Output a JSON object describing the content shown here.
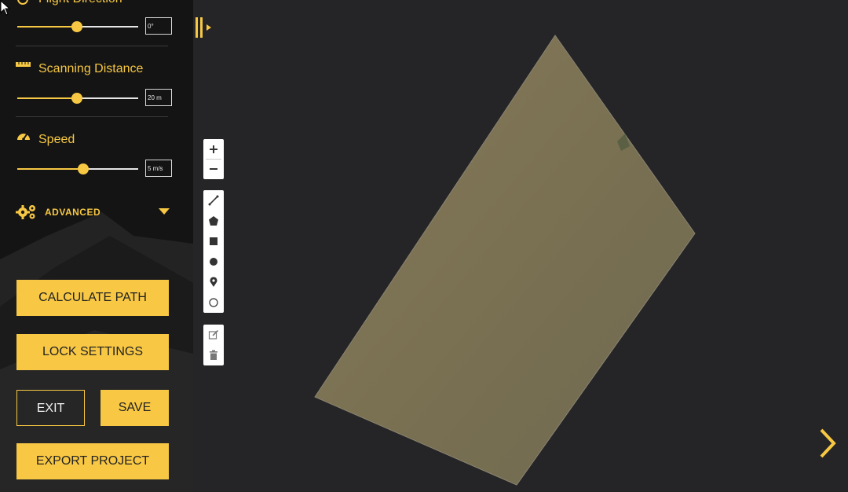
{
  "sidebar": {
    "flight_direction": {
      "label": "Flight Direction",
      "value": "0°",
      "level": 0.5
    },
    "scanning_distance": {
      "label": "Scanning Distance",
      "value": "20 m",
      "level": 0.5
    },
    "speed": {
      "label": "Speed",
      "value": "5 m/s",
      "level": 0.55
    },
    "advanced": {
      "label": "ADVANCED"
    },
    "buttons": {
      "calculate": "CALCULATE PATH",
      "lock": "LOCK SETTINGS",
      "exit": "EXIT",
      "save": "SAVE",
      "export": "EXPORT PROJECT"
    }
  },
  "map_tools": {
    "zoom": [
      "zoom-in",
      "zoom-out"
    ],
    "draw": [
      "polyline",
      "polygon",
      "rectangle",
      "circle",
      "marker",
      "circle-marker"
    ],
    "edit": [
      "edit-layers",
      "delete-layers"
    ]
  },
  "colors": {
    "accent": "#f8c844",
    "sidebar_bg": "#141414",
    "map_bg": "#252527",
    "field": "#7d7355"
  }
}
